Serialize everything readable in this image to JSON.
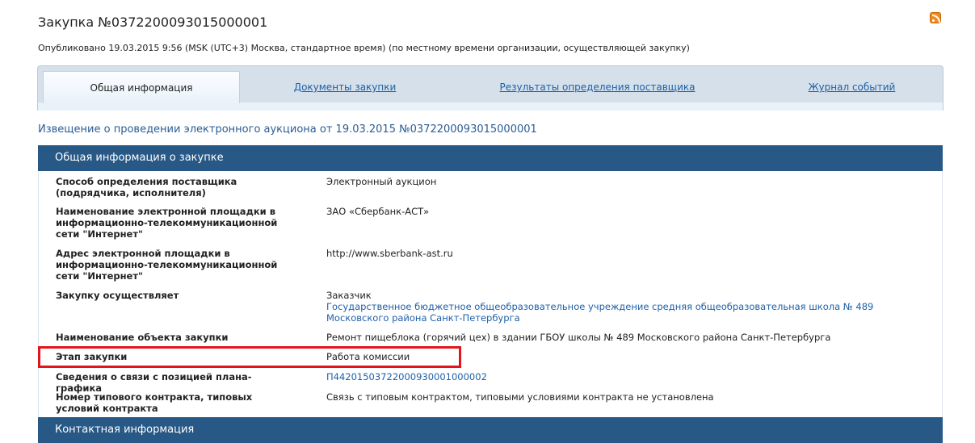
{
  "title": "Закупка №0372200093015000001",
  "published": "Опубликовано 19.03.2015 9:56 (MSK (UTC+3) Москва, стандартное время) (по местному времени организации, осуществляющей закупку)",
  "tabs": [
    "Общая информация",
    "Документы закупки",
    "Результаты определения поставщика",
    "Журнал событий"
  ],
  "notice": "Извещение о проведении электронного аукциона от 19.03.2015 №0372200093015000001",
  "section1": "Общая информация о закупке",
  "rows": [
    {
      "label": "Способ определения поставщика (подрядчика, исполнителя)",
      "value": "Электронный аукцион"
    },
    {
      "label": "Наименование электронной площадки в информационно-телекоммуникационной сети \"Интернет\"",
      "value": "ЗАО «Сбербанк-АСТ»"
    },
    {
      "label": "Адрес электронной площадки в информационно-телекоммуникационной сети \"Интернет\"",
      "value": "http://www.sberbank-ast.ru"
    },
    {
      "label": "Закупку осуществляет",
      "value": "Заказчик",
      "link": "Государственное бюджетное общеобразовательное учреждение средняя общеобразовательная школа № 489 Московского района Санкт-Петербурга"
    },
    {
      "label": "Наименование объекта закупки",
      "value": "Ремонт пищеблока (горячий цех) в здании ГБОУ школы № 489 Московского района Санкт-Петербурга"
    },
    {
      "label": "Этап закупки",
      "value": "Работа комиссии"
    },
    {
      "label": "Сведения о связи с позицией плана-графика",
      "value": "П44201503722000930001000002"
    },
    {
      "label": "Номер типового контракта, типовых условий контракта",
      "value": "Связь с типовым контрактом, типовыми условиями контракта не установлена"
    }
  ],
  "section2": "Контактная информация"
}
